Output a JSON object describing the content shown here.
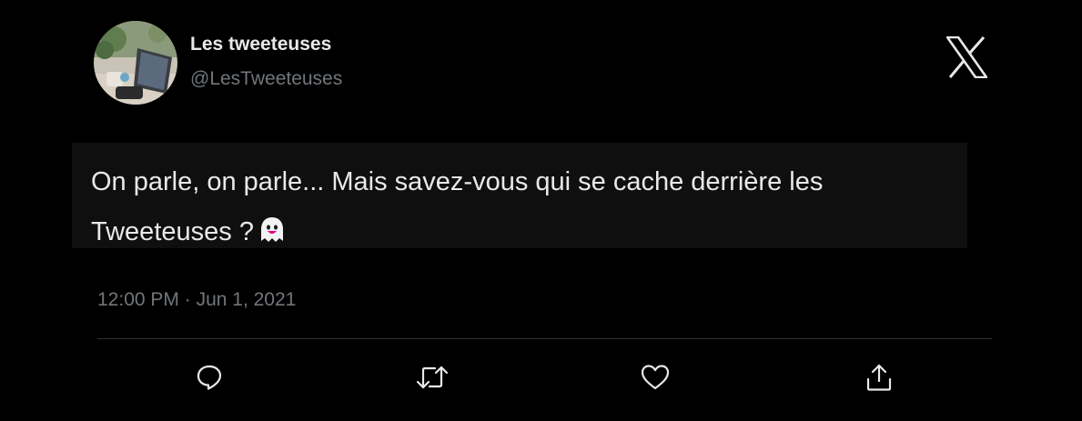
{
  "author": {
    "name": "Les tweeteuses",
    "handle": "@LesTweeteuses",
    "avatar_icon": "profile-avatar-laptop-desk"
  },
  "platform_logo": "x-logo-icon",
  "tweet": {
    "text": "On parle, on parle... Mais savez-vous qui se cache derrière les Tweeteuses ?",
    "emoji_icon": "ghost-icon",
    "time": "12:00 PM",
    "separator": "·",
    "date": "Jun 1, 2021"
  },
  "actions": [
    {
      "name": "reply",
      "icon": "reply-icon"
    },
    {
      "name": "retweet",
      "icon": "retweet-icon"
    },
    {
      "name": "like",
      "icon": "heart-icon"
    },
    {
      "name": "share",
      "icon": "share-icon"
    }
  ],
  "colors": {
    "background": "#000000",
    "text_primary": "#e7e9ea",
    "text_secondary": "#71767b",
    "divider": "#2f3336",
    "tweet_body_bg": "#0f0f0f",
    "ghost_tongue": "#e6007e"
  }
}
